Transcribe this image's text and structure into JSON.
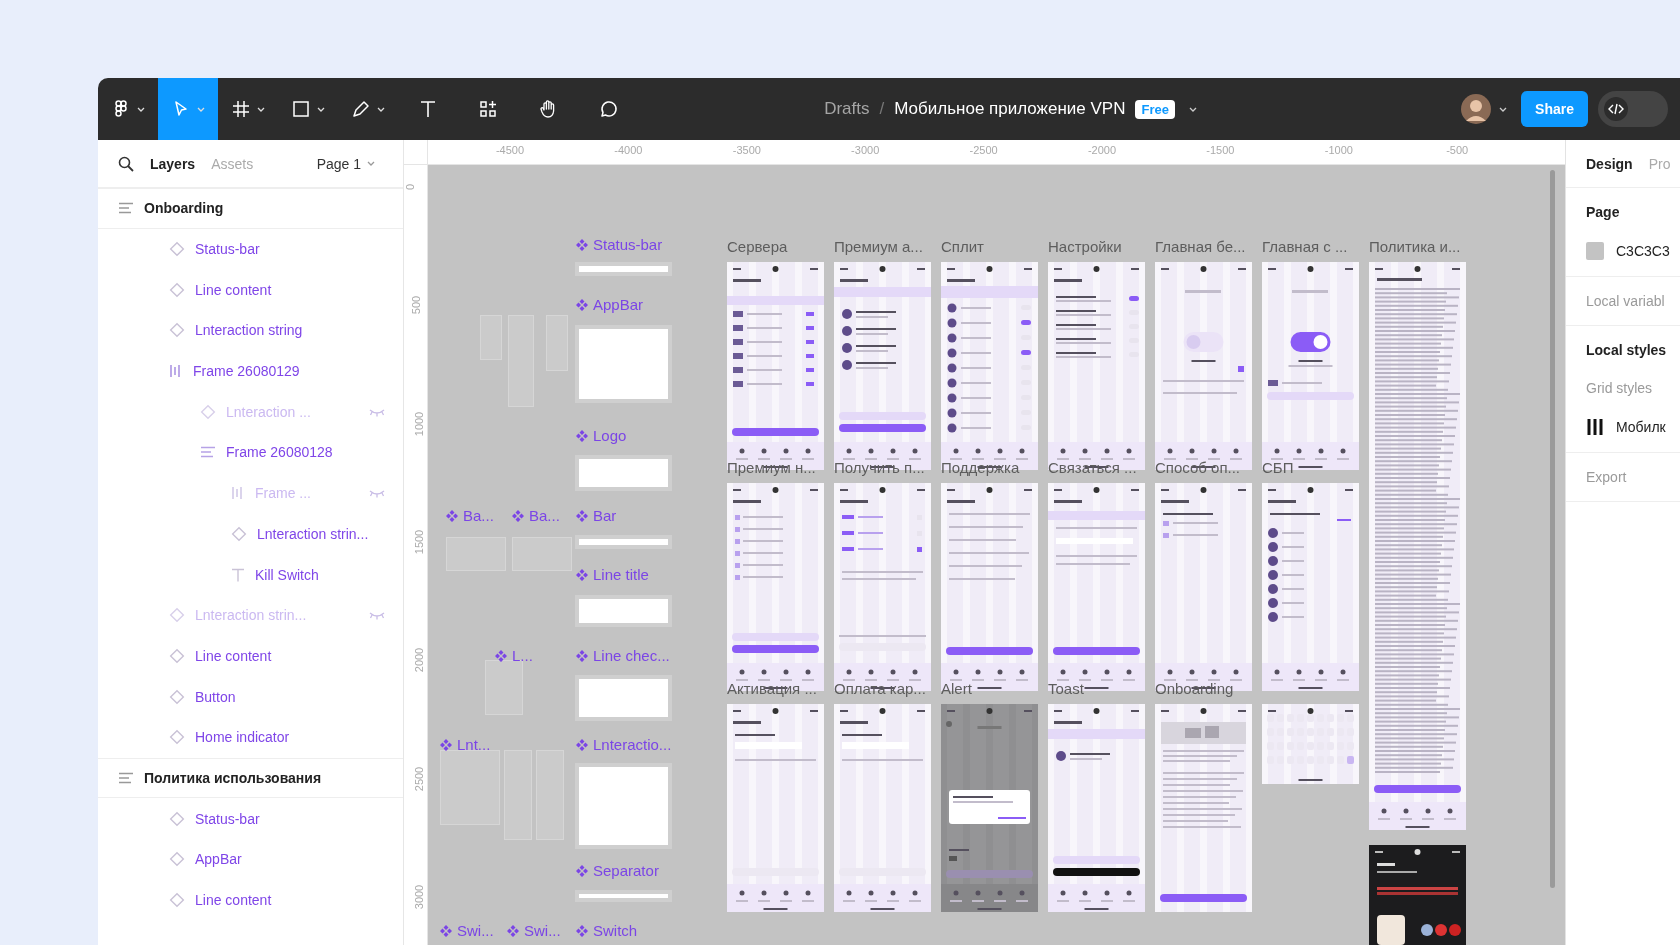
{
  "toolbar": {
    "tools": [
      {
        "kind": "menu",
        "selected": false,
        "dropdown": true
      },
      {
        "kind": "move",
        "selected": true,
        "dropdown": true
      },
      {
        "kind": "frame",
        "selected": false,
        "dropdown": true
      },
      {
        "kind": "shape",
        "selected": false,
        "dropdown": true
      },
      {
        "kind": "pen",
        "selected": false,
        "dropdown": true
      },
      {
        "kind": "text",
        "selected": false,
        "dropdown": false
      },
      {
        "kind": "resources",
        "selected": false,
        "dropdown": false
      },
      {
        "kind": "hand",
        "selected": false,
        "dropdown": false
      },
      {
        "kind": "comment",
        "selected": false,
        "dropdown": false
      }
    ],
    "breadcrumb": {
      "folder": "Drafts",
      "separator": "/",
      "file": "Мобильное приложение VPN",
      "plan_badge": "Free"
    },
    "share_button": "Share",
    "dev_mode": false
  },
  "layers_panel": {
    "tabs": [
      {
        "label": "Layers",
        "selected": true
      },
      {
        "label": "Assets",
        "selected": false
      }
    ],
    "page_selector": "Page 1",
    "layers": [
      {
        "name": "Onboarding",
        "kind": "section",
        "hidden": false,
        "children": [
          {
            "name": "Status-bar",
            "kind": "component",
            "hidden": false
          },
          {
            "name": "Line content",
            "kind": "component",
            "hidden": false
          },
          {
            "name": "Lnteraction string",
            "kind": "component",
            "hidden": false
          },
          {
            "name": "Frame 26080129",
            "kind": "frame-columns",
            "hidden": false,
            "children": [
              {
                "name": "Lnteraction ...",
                "kind": "component",
                "hidden": true
              },
              {
                "name": "Frame 26080128",
                "kind": "frame-rows",
                "hidden": false,
                "children": [
                  {
                    "name": "Frame ...",
                    "kind": "frame-columns",
                    "hidden": true
                  },
                  {
                    "name": "Lnteraction strin...",
                    "kind": "component",
                    "hidden": false
                  },
                  {
                    "name": "Kill Switch",
                    "kind": "text",
                    "hidden": false
                  }
                ]
              }
            ]
          },
          {
            "name": "Lnteraction strin...",
            "kind": "component",
            "hidden": true
          },
          {
            "name": "Line content",
            "kind": "component",
            "hidden": false
          },
          {
            "name": "Button",
            "kind": "component",
            "hidden": false
          },
          {
            "name": "Home indicator",
            "kind": "component",
            "hidden": false
          }
        ]
      },
      {
        "name": "Политика использования",
        "kind": "section",
        "hidden": false,
        "children": [
          {
            "name": "Status-bar",
            "kind": "component",
            "hidden": false
          },
          {
            "name": "AppBar",
            "kind": "component",
            "hidden": false
          },
          {
            "name": "Line content",
            "kind": "component",
            "hidden": false
          }
        ]
      }
    ]
  },
  "ruler": {
    "x_labels": [
      "-4500",
      "-4000",
      "-3500",
      "-3000",
      "-2500",
      "-2000",
      "-1500",
      "-1000",
      "-500"
    ],
    "y_labels": [
      "0",
      "500",
      "1000",
      "1500",
      "2000",
      "2500",
      "3000"
    ]
  },
  "canvas": {
    "components": [
      {
        "label": "Status-bar"
      },
      {
        "label": "AppBar"
      },
      {
        "label": "Logo"
      },
      {
        "label": "Ba..."
      },
      {
        "label": "Ba..."
      },
      {
        "label": "Bar"
      },
      {
        "label": "Line title"
      },
      {
        "label": "L..."
      },
      {
        "label": "Line chec..."
      },
      {
        "label": "Lnt..."
      },
      {
        "label": "Lnteractio..."
      },
      {
        "label": "Separator"
      },
      {
        "label": "Swi..."
      },
      {
        "label": "Swi..."
      },
      {
        "label": "Switch"
      }
    ],
    "frame_rows": [
      [
        {
          "title": "Сервера",
          "kind": "servers"
        },
        {
          "title": "Премиум а...",
          "kind": "devices"
        },
        {
          "title": "Сплит",
          "kind": "split"
        },
        {
          "title": "Настройки",
          "kind": "settings"
        },
        {
          "title": "Главная бе...",
          "kind": "toggle-off"
        },
        {
          "title": "Главная с ...",
          "kind": "toggle-on"
        },
        {
          "title": "Политика и...",
          "kind": "document"
        }
      ],
      [
        {
          "title": "Премиум н...",
          "kind": "benefits"
        },
        {
          "title": "Получить п...",
          "kind": "pricing"
        },
        {
          "title": "Поддержка",
          "kind": "faq"
        },
        {
          "title": "Связаться ...",
          "kind": "contact"
        },
        {
          "title": "Способ оп...",
          "kind": "payment"
        },
        {
          "title": "СБП",
          "kind": "sbp"
        }
      ],
      [
        {
          "title": "Активация ...",
          "kind": "form"
        },
        {
          "title": "Оплата кар...",
          "kind": "form"
        },
        {
          "title": "Alert",
          "kind": "alert"
        },
        {
          "title": "Toast",
          "kind": "toast"
        },
        {
          "title": "Onboarding",
          "kind": "onboarding"
        },
        {
          "kind": "keyboard"
        },
        {
          "kind": "lock-screen"
        }
      ]
    ]
  },
  "design_panel": {
    "tabs": [
      {
        "label": "Design",
        "selected": true
      },
      {
        "label": "Pro",
        "selected": false
      }
    ],
    "page": {
      "heading": "Page",
      "color": "C3C3C3"
    },
    "local_variables": "Local variabl",
    "local_styles": {
      "heading": "Local styles",
      "grid_heading": "Grid styles",
      "grid_style": "Мобилк"
    },
    "export": "Export"
  }
}
